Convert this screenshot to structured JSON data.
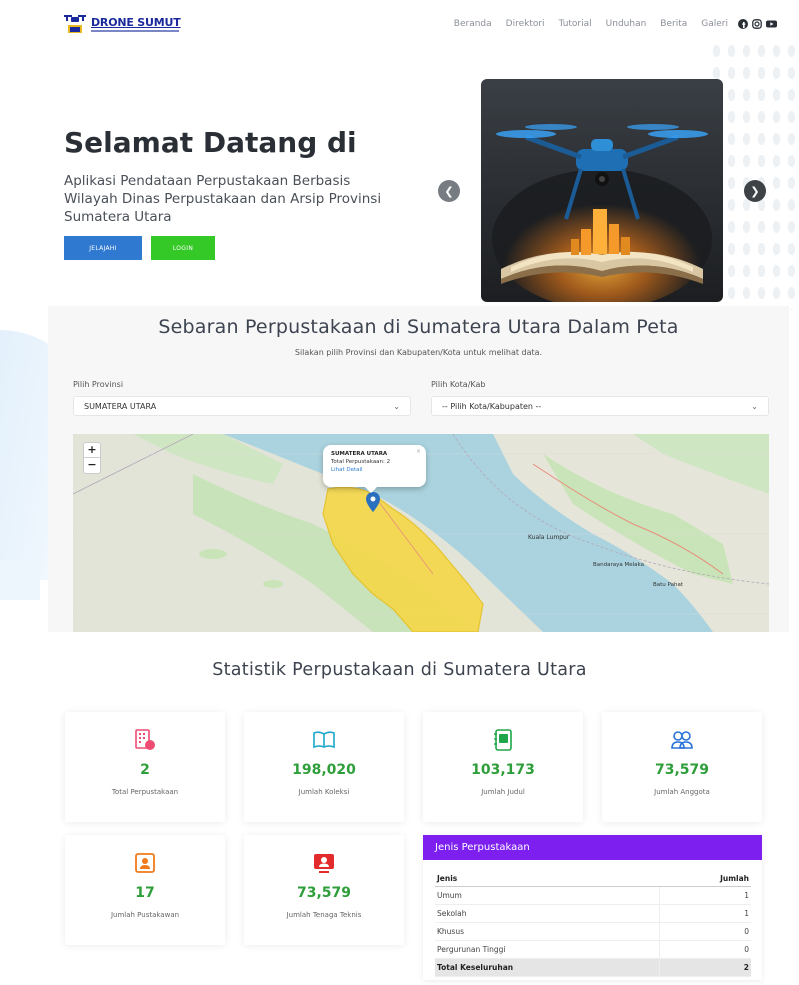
{
  "header": {
    "logo_title": "DRONE SUMUT",
    "nav": [
      "Beranda",
      "Direktori",
      "Tutorial",
      "Unduhan",
      "Berita",
      "Galeri"
    ],
    "social_icons": [
      "facebook-icon",
      "instagram-icon",
      "youtube-icon"
    ]
  },
  "hero": {
    "title": "Selamat Datang di",
    "description": "Aplikasi Pendataan Perpustakaan Berbasis Wilayah Dinas Perpustakaan dan Arsip Provinsi Sumatera Utara",
    "btn_jelajahi": "JELAJAHI",
    "btn_login": "LOGIN",
    "arrow_left": "❮",
    "arrow_right": "❯"
  },
  "map_section": {
    "title": "Sebaran Perpustakaan di Sumatera Utara Dalam Peta",
    "subtitle": "Silakan pilih Provinsi dan Kabupaten/Kota untuk melihat data.",
    "provinsi_label": "Pilih Provinsi",
    "provinsi_value": "SUMATERA UTARA",
    "kota_label": "Pilih Kota/Kab",
    "kota_value": "-- Pilih Kota/Kabupaten --",
    "zoom_in": "+",
    "zoom_out": "−",
    "popup": {
      "title": "SUMATERA UTARA",
      "line": "Total Perpustakaan: 2",
      "link": "Lihat Detail",
      "close": "×"
    },
    "map_labels": [
      "Kuala Lumpur",
      "Bandaraya Melaka",
      "Batu Pahat"
    ]
  },
  "stats": {
    "title": "Statistik Perpustakaan di Sumatera Utara",
    "cards": [
      {
        "value": "2",
        "label": "Total Perpustakaan"
      },
      {
        "value": "198,020",
        "label": "Jumlah Koleksi"
      },
      {
        "value": "103,173",
        "label": "Jumlah Judul"
      },
      {
        "value": "73,579",
        "label": "Jumlah Anggota"
      },
      {
        "value": "17",
        "label": "Jumlah Pustakawan"
      },
      {
        "value": "73,579",
        "label": "Jumlah Tenaga Teknis"
      }
    ],
    "jenis": {
      "header": "Jenis Perpustakaan",
      "col_jenis": "Jenis",
      "col_jumlah": "Jumlah",
      "rows": [
        {
          "jenis": "Umum",
          "jumlah": "1"
        },
        {
          "jenis": "Sekolah",
          "jumlah": "1"
        },
        {
          "jenis": "Khusus",
          "jumlah": "0"
        },
        {
          "jenis": "Pergurunan Tinggi",
          "jumlah": "0"
        }
      ],
      "total_label": "Total Keseluruhan",
      "total_value": "2"
    }
  },
  "colors": {
    "primary_blue": "#2f79d1",
    "login_green": "#35c927",
    "stat_green": "#2e9e3a",
    "jenis_purple": "#7c1fef"
  }
}
